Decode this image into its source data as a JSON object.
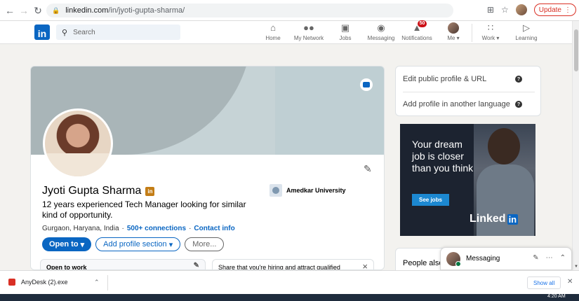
{
  "browser": {
    "url_host": "linkedin.com",
    "url_path": "/in/jyoti-gupta-sharma/",
    "update_label": "Update",
    "back_icon": "arrow-left-icon",
    "forward_icon": "arrow-right-icon",
    "reload_icon": "reload-icon"
  },
  "header": {
    "logo": "in",
    "search_placeholder": "Search",
    "nav": [
      {
        "label": "Home",
        "icon": "home-icon"
      },
      {
        "label": "My Network",
        "icon": "network-icon"
      },
      {
        "label": "Jobs",
        "icon": "briefcase-icon"
      },
      {
        "label": "Messaging",
        "icon": "chat-icon"
      },
      {
        "label": "Notifications",
        "icon": "bell-icon",
        "badge": "50"
      },
      {
        "label": "Me",
        "icon": "avatar-icon"
      },
      {
        "label": "Work",
        "icon": "grid-icon"
      },
      {
        "label": "Learning",
        "icon": "play-icon"
      }
    ]
  },
  "profile": {
    "name": "Jyoti Gupta Sharma",
    "headline": "12 years experienced Tech Manager looking for similar kind of opportunity.",
    "location": "Gurgaon, Haryana, India",
    "separator": "·",
    "connections": "500+ connections",
    "contact_info": "Contact info",
    "education": "Amedkar University",
    "buttons": {
      "open_to": "Open to",
      "add_section": "Add profile section",
      "more": "More..."
    },
    "open_to_work": "Open to work",
    "hiring_text": "Share that you're hiring and attract qualified"
  },
  "sidebar": {
    "edit_profile_url": "Edit public profile & URL",
    "add_language": "Add profile in another language",
    "ad": {
      "text": "Your dream job is closer than you think",
      "button": "See jobs",
      "brand": "Linked",
      "brand_box": "in"
    },
    "people_also": "People also"
  },
  "messaging": {
    "title": "Messaging"
  },
  "downloads": {
    "file": "AnyDesk (2).exe",
    "show_all": "Show all"
  },
  "taskbar": {
    "time": "4:20 AM"
  },
  "colors": {
    "brand": "#0a66c2",
    "background": "#f3f2ef",
    "badge": "#cc1016"
  }
}
